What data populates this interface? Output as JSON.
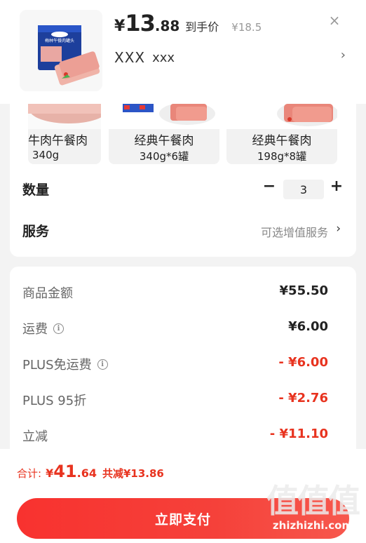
{
  "header": {
    "price_yen": "¥",
    "price_int": "13",
    "price_dec": ".88",
    "price_tag": "到手价",
    "original_price": "¥18.5",
    "spec_main": "XXX",
    "spec_sub": "xxx",
    "spec_arrow": "›",
    "close": "×",
    "product_can_label": "梅林午餐肉罐头"
  },
  "variants": [
    {
      "name": "牛肉午餐肉",
      "weight": "340g"
    },
    {
      "name": "经典午餐肉",
      "weight": "340g*6罐"
    },
    {
      "name": "经典午餐肉",
      "weight": "198g*8罐"
    }
  ],
  "quantity": {
    "label": "数量",
    "value": "3",
    "minus": "−",
    "plus": "+"
  },
  "service": {
    "label": "服务",
    "value": "可选增值服务",
    "arrow": "›"
  },
  "costs": [
    {
      "label": "商品金额",
      "value": "¥55.50",
      "info": false,
      "red": false
    },
    {
      "label": "运费",
      "value": "¥6.00",
      "info": true,
      "red": false
    },
    {
      "label": "PLUS免运费",
      "value": "- ¥6.00",
      "info": true,
      "red": true
    },
    {
      "label": "PLUS 95折",
      "value": "- ¥2.76",
      "info": false,
      "red": true
    },
    {
      "label": "立减",
      "value": "- ¥11.10",
      "info": false,
      "red": true
    }
  ],
  "footer": {
    "total_label": "合计:",
    "total_yen": "¥",
    "total_int": "41",
    "total_dec": ".64",
    "total_save": "共减¥13.86",
    "pay_button": "立即支付"
  },
  "watermark": {
    "big": "值值值",
    "small": "zhizhizhi.com"
  },
  "colors": {
    "accent": "#e8331f",
    "pay_button": "#f5413a",
    "background": "#f3f3f3"
  }
}
